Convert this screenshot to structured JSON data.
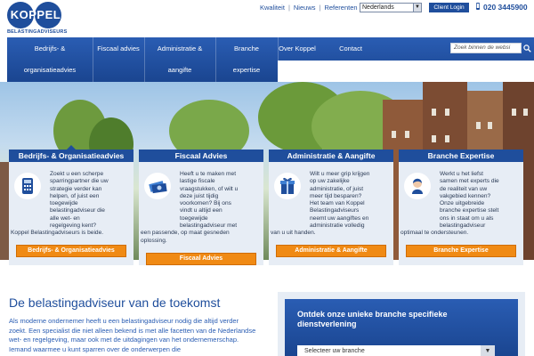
{
  "brand": {
    "logo_text": "KOPPEL",
    "logo_sub": "BELASTINGADVISEURS",
    "primary_color": "#1f4e9c",
    "accent_color": "#f08a14"
  },
  "toplinks": [
    "Kwaliteit",
    "Nieuws",
    "Referenten"
  ],
  "language": {
    "selected": "Nederlands"
  },
  "client_login": "Client Login",
  "phone": "020 3445900",
  "nav": {
    "items": [
      {
        "l1": "Bedrijfs- &",
        "l2": "organisatieadvies"
      },
      {
        "l1": "Fiscaal advies",
        "l2": ""
      },
      {
        "l1": "Administratie &",
        "l2": "aangifte"
      },
      {
        "l1": "Branche",
        "l2": "expertise"
      },
      {
        "l1": "Over Koppel",
        "l2": ""
      },
      {
        "l1": "Contact",
        "l2": ""
      }
    ],
    "search_placeholder": "Zoek binnen de websi"
  },
  "cards": [
    {
      "title": "Bedrijfs- & Organisatieadvies",
      "icon": "calculator-icon",
      "lines_indent": [
        "Zoekt u een scherpe",
        "sparringpartner die uw",
        "strategie verder kan",
        "helpen, of juist een",
        "toegewijde",
        "belastingadviseur die",
        "alle wet- en",
        "regelgeving kent?"
      ],
      "lines_full": [
        "Koppel Belastingadviseurs is beide."
      ],
      "button": "Bedrijfs- & Organisatieadvies"
    },
    {
      "title": "Fiscaal Advies",
      "icon": "money-icon",
      "lines_indent": [
        "Heeft u te maken met",
        "lastige fiscale",
        "vraagstukken, of wilt u",
        "deze juist tijdig",
        "voorkomen? Bij ons",
        "vindt u altijd een",
        "toegewijde",
        "belastingadviseur met"
      ],
      "lines_full": [
        "een passende, op maat gesneden",
        "oplossing."
      ],
      "button": "Fiscaal Advies"
    },
    {
      "title": "Administratie & Aangifte",
      "icon": "gift-icon",
      "lines_indent": [
        "Wilt u meer grip krijgen",
        "op uw zakelijke",
        "administratie, of juist",
        "meer tijd besparen?",
        "Het team van Koppel",
        "Belastingadviseurs",
        "neemt uw aangiftes en",
        "administratie volledig"
      ],
      "lines_full": [
        "van u uit handen."
      ],
      "button": "Administratie & Aangifte"
    },
    {
      "title": "Branche Expertise",
      "icon": "person-icon",
      "lines_indent": [
        "Werkt u het liefst",
        "samen met experts die",
        "de realiteit van uw",
        "vakgebied kennen?",
        "Onze uitgebreide",
        "branche expertise stelt",
        "ons in staat om u als",
        "belastingadviseur"
      ],
      "lines_full": [
        "optimaal te ondersteunen."
      ],
      "button": "Branche Expertise"
    }
  ],
  "main": {
    "title": "De belastingadviseur van de toekomst",
    "body": "Als moderne ondernemer heeft u een belastingadviseur nodig die altijd verder zoekt. Een specialist die niet alleen bekend is met alle facetten van de Nederlandse wet- en regelgeving, maar ook met de uitdagingen van het ondernemerschap. Iemand waarmee u kunt sparren over de onderwerpen die"
  },
  "promo": {
    "title": "Ontdek onze unieke branche specifieke dienstverlening",
    "select_placeholder": "Selecteer uw branche"
  }
}
